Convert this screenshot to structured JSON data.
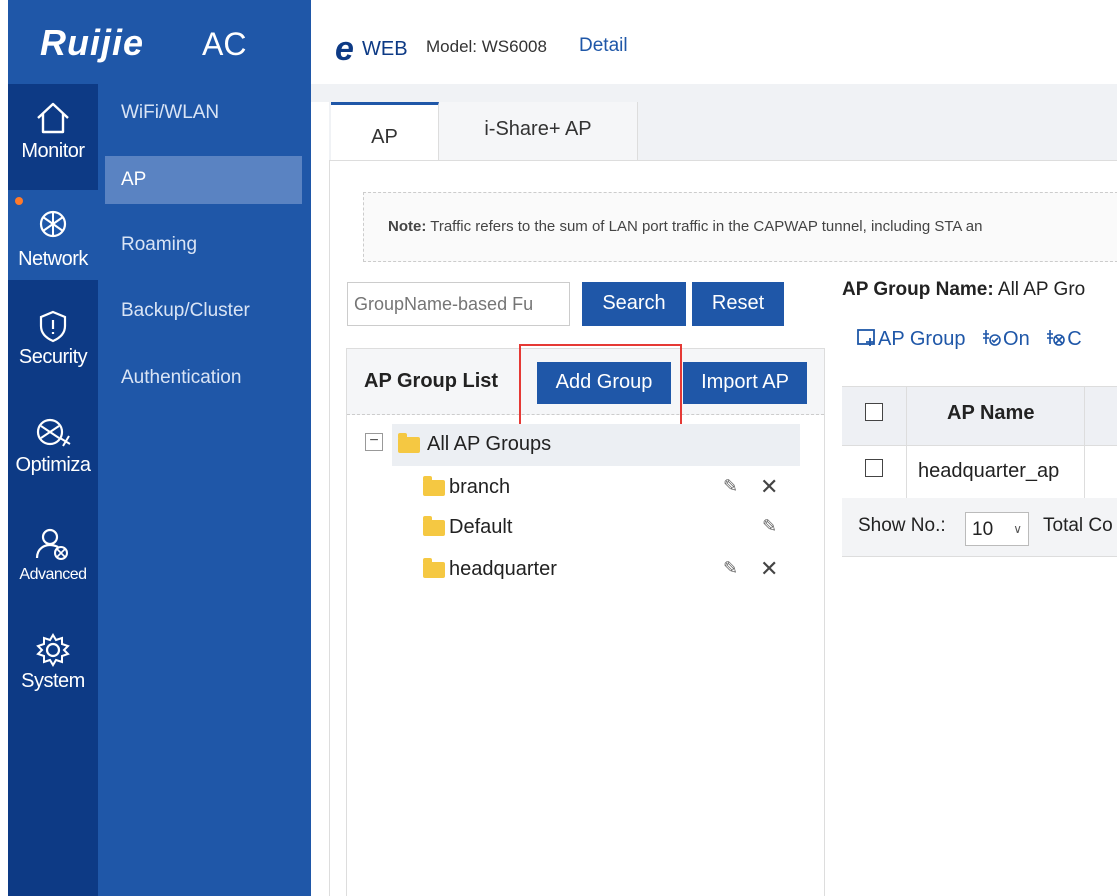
{
  "brand": {
    "logo": "Ruijie",
    "product": "AC"
  },
  "header": {
    "eweb_e": "e",
    "eweb_rest": "WEB",
    "model": "Model: WS6008",
    "detail_link": "Detail"
  },
  "rail": [
    {
      "label": "Monitor",
      "icon": "home-icon"
    },
    {
      "label": "Network",
      "icon": "network-icon",
      "active": true
    },
    {
      "label": "Security",
      "icon": "shield-icon"
    },
    {
      "label": "Optimiza",
      "icon": "optimize-icon"
    },
    {
      "label": "Advanced",
      "icon": "advanced-user-icon"
    },
    {
      "label": "System",
      "icon": "gear-icon"
    }
  ],
  "submenu": [
    {
      "label": "WiFi/WLAN"
    },
    {
      "label": "AP",
      "active": true
    },
    {
      "label": "Roaming"
    },
    {
      "label": "Backup/Cluster"
    },
    {
      "label": "Authentication"
    }
  ],
  "tabs": [
    {
      "label": "AP",
      "active": true
    },
    {
      "label": "i-Share+ AP"
    }
  ],
  "note": {
    "bold": "Note:",
    "text": " Traffic refers to the sum of LAN port traffic in the CAPWAP tunnel, including STA an"
  },
  "search": {
    "placeholder": "GroupName-based Fu",
    "search_label": "Search",
    "reset_label": "Reset"
  },
  "group_panel": {
    "title": "AP Group List",
    "add_group": "Add Group",
    "import_ap": "Import AP",
    "root": "All AP Groups",
    "groups": [
      {
        "name": "branch",
        "editable": true,
        "deletable": true
      },
      {
        "name": "Default",
        "editable": true,
        "deletable": false
      },
      {
        "name": "headquarter",
        "editable": true,
        "deletable": true
      }
    ]
  },
  "right": {
    "group_name_label": "AP Group Name:",
    "group_name_value": " All AP Gro",
    "toolbar": {
      "ap_group": "AP Group",
      "on": "On",
      "off_partial": "C"
    },
    "table": {
      "header": "AP Name",
      "rows": [
        {
          "ap_name": "headquarter_ap"
        }
      ]
    },
    "pager": {
      "show_label": "Show No.:",
      "page_size": "10",
      "total_label": "Total Co"
    }
  },
  "colors": {
    "sidebar_dark": "#0d3a85",
    "sidebar": "#1f57a8",
    "accent": "#1f57a8",
    "highlight": "#e53935",
    "folder": "#f5c842"
  }
}
